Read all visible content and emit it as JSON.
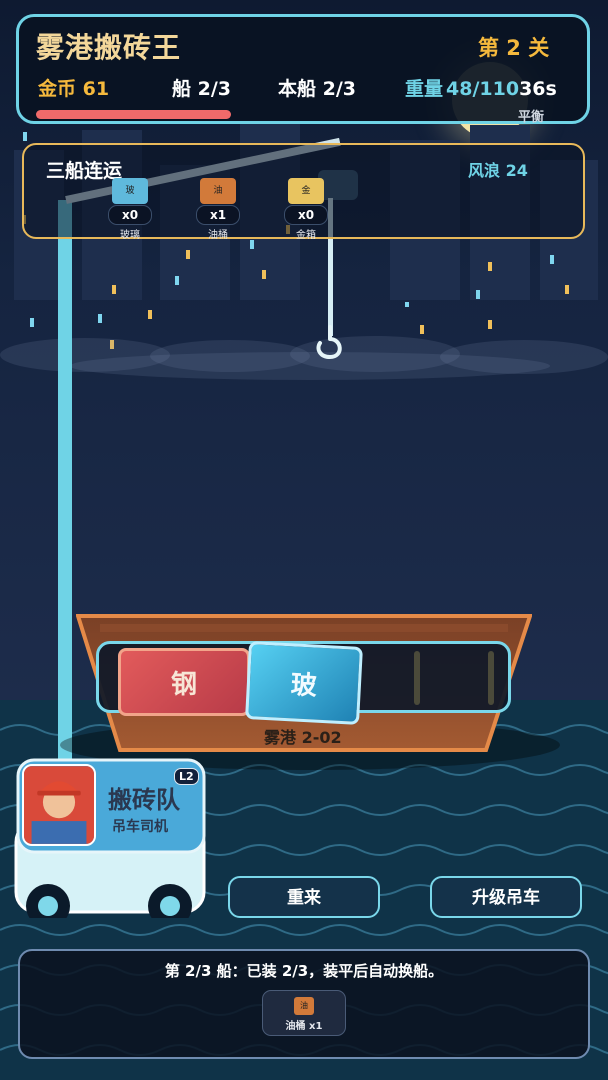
{
  "hud": {
    "title": "雾港搬砖王",
    "level": "第 2 关",
    "coins": "金币 61",
    "ships": "船 2/3",
    "this_ship": "本船 2/3",
    "weight_label": "重量",
    "weight_value": "48/110",
    "timer": "36s",
    "balance": "平衡",
    "balance_level": 0.39
  },
  "combo": {
    "title": "三船连运",
    "wind": "风浪 24",
    "items": [
      {
        "icon_text": "玻",
        "count": "x0",
        "name": "玻璃",
        "color": "#5fb9dc"
      },
      {
        "icon_text": "油",
        "count": "x1",
        "name": "油桶",
        "color": "#d27a3a"
      },
      {
        "icon_text": "金",
        "count": "x0",
        "name": "金箱",
        "color": "#e8c460"
      }
    ]
  },
  "ship": {
    "name": "雾港 2-02",
    "boxes": [
      {
        "label": "钢",
        "color": "#e25b5b"
      },
      {
        "label": "玻",
        "color": "#3fb6e0"
      }
    ]
  },
  "team": {
    "name": "搬砖队",
    "role": "吊车司机",
    "level": "L2"
  },
  "buttons": {
    "retry": "重来",
    "upgrade": "升级吊车"
  },
  "footer": {
    "status": "第 2/3 船：已装 2/3，装平后自动换船。",
    "inventory_icon_text": "油",
    "inventory_label": "油桶 x1"
  },
  "colors": {
    "accent": "#6fd3e6",
    "gold": "#f5b93d",
    "danger": "#ef6a6a"
  }
}
